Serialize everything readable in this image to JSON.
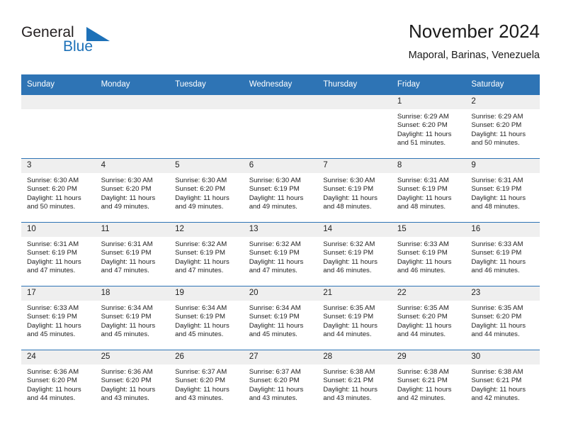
{
  "brand": {
    "name_part1": "General",
    "name_part2": "Blue",
    "logo_icon": "triangle-logo-icon",
    "accent_color": "#1d71b8"
  },
  "header": {
    "title": "November 2024",
    "subtitle": "Maporal, Barinas, Venezuela"
  },
  "theme": {
    "header_band_color": "#2e74b5",
    "daynum_band_color": "#efefef",
    "text_color": "#222222"
  },
  "calendar": {
    "weekday_headers": [
      "Sunday",
      "Monday",
      "Tuesday",
      "Wednesday",
      "Thursday",
      "Friday",
      "Saturday"
    ],
    "weeks": [
      [
        {
          "day": "",
          "empty": true
        },
        {
          "day": "",
          "empty": true
        },
        {
          "day": "",
          "empty": true
        },
        {
          "day": "",
          "empty": true
        },
        {
          "day": "",
          "empty": true
        },
        {
          "day": "1",
          "sunrise": "Sunrise: 6:29 AM",
          "sunset": "Sunset: 6:20 PM",
          "daylight1": "Daylight: 11 hours",
          "daylight2": "and 51 minutes."
        },
        {
          "day": "2",
          "sunrise": "Sunrise: 6:29 AM",
          "sunset": "Sunset: 6:20 PM",
          "daylight1": "Daylight: 11 hours",
          "daylight2": "and 50 minutes."
        }
      ],
      [
        {
          "day": "3",
          "sunrise": "Sunrise: 6:30 AM",
          "sunset": "Sunset: 6:20 PM",
          "daylight1": "Daylight: 11 hours",
          "daylight2": "and 50 minutes."
        },
        {
          "day": "4",
          "sunrise": "Sunrise: 6:30 AM",
          "sunset": "Sunset: 6:20 PM",
          "daylight1": "Daylight: 11 hours",
          "daylight2": "and 49 minutes."
        },
        {
          "day": "5",
          "sunrise": "Sunrise: 6:30 AM",
          "sunset": "Sunset: 6:20 PM",
          "daylight1": "Daylight: 11 hours",
          "daylight2": "and 49 minutes."
        },
        {
          "day": "6",
          "sunrise": "Sunrise: 6:30 AM",
          "sunset": "Sunset: 6:19 PM",
          "daylight1": "Daylight: 11 hours",
          "daylight2": "and 49 minutes."
        },
        {
          "day": "7",
          "sunrise": "Sunrise: 6:30 AM",
          "sunset": "Sunset: 6:19 PM",
          "daylight1": "Daylight: 11 hours",
          "daylight2": "and 48 minutes."
        },
        {
          "day": "8",
          "sunrise": "Sunrise: 6:31 AM",
          "sunset": "Sunset: 6:19 PM",
          "daylight1": "Daylight: 11 hours",
          "daylight2": "and 48 minutes."
        },
        {
          "day": "9",
          "sunrise": "Sunrise: 6:31 AM",
          "sunset": "Sunset: 6:19 PM",
          "daylight1": "Daylight: 11 hours",
          "daylight2": "and 48 minutes."
        }
      ],
      [
        {
          "day": "10",
          "sunrise": "Sunrise: 6:31 AM",
          "sunset": "Sunset: 6:19 PM",
          "daylight1": "Daylight: 11 hours",
          "daylight2": "and 47 minutes."
        },
        {
          "day": "11",
          "sunrise": "Sunrise: 6:31 AM",
          "sunset": "Sunset: 6:19 PM",
          "daylight1": "Daylight: 11 hours",
          "daylight2": "and 47 minutes."
        },
        {
          "day": "12",
          "sunrise": "Sunrise: 6:32 AM",
          "sunset": "Sunset: 6:19 PM",
          "daylight1": "Daylight: 11 hours",
          "daylight2": "and 47 minutes."
        },
        {
          "day": "13",
          "sunrise": "Sunrise: 6:32 AM",
          "sunset": "Sunset: 6:19 PM",
          "daylight1": "Daylight: 11 hours",
          "daylight2": "and 47 minutes."
        },
        {
          "day": "14",
          "sunrise": "Sunrise: 6:32 AM",
          "sunset": "Sunset: 6:19 PM",
          "daylight1": "Daylight: 11 hours",
          "daylight2": "and 46 minutes."
        },
        {
          "day": "15",
          "sunrise": "Sunrise: 6:33 AM",
          "sunset": "Sunset: 6:19 PM",
          "daylight1": "Daylight: 11 hours",
          "daylight2": "and 46 minutes."
        },
        {
          "day": "16",
          "sunrise": "Sunrise: 6:33 AM",
          "sunset": "Sunset: 6:19 PM",
          "daylight1": "Daylight: 11 hours",
          "daylight2": "and 46 minutes."
        }
      ],
      [
        {
          "day": "17",
          "sunrise": "Sunrise: 6:33 AM",
          "sunset": "Sunset: 6:19 PM",
          "daylight1": "Daylight: 11 hours",
          "daylight2": "and 45 minutes."
        },
        {
          "day": "18",
          "sunrise": "Sunrise: 6:34 AM",
          "sunset": "Sunset: 6:19 PM",
          "daylight1": "Daylight: 11 hours",
          "daylight2": "and 45 minutes."
        },
        {
          "day": "19",
          "sunrise": "Sunrise: 6:34 AM",
          "sunset": "Sunset: 6:19 PM",
          "daylight1": "Daylight: 11 hours",
          "daylight2": "and 45 minutes."
        },
        {
          "day": "20",
          "sunrise": "Sunrise: 6:34 AM",
          "sunset": "Sunset: 6:19 PM",
          "daylight1": "Daylight: 11 hours",
          "daylight2": "and 45 minutes."
        },
        {
          "day": "21",
          "sunrise": "Sunrise: 6:35 AM",
          "sunset": "Sunset: 6:19 PM",
          "daylight1": "Daylight: 11 hours",
          "daylight2": "and 44 minutes."
        },
        {
          "day": "22",
          "sunrise": "Sunrise: 6:35 AM",
          "sunset": "Sunset: 6:20 PM",
          "daylight1": "Daylight: 11 hours",
          "daylight2": "and 44 minutes."
        },
        {
          "day": "23",
          "sunrise": "Sunrise: 6:35 AM",
          "sunset": "Sunset: 6:20 PM",
          "daylight1": "Daylight: 11 hours",
          "daylight2": "and 44 minutes."
        }
      ],
      [
        {
          "day": "24",
          "sunrise": "Sunrise: 6:36 AM",
          "sunset": "Sunset: 6:20 PM",
          "daylight1": "Daylight: 11 hours",
          "daylight2": "and 44 minutes."
        },
        {
          "day": "25",
          "sunrise": "Sunrise: 6:36 AM",
          "sunset": "Sunset: 6:20 PM",
          "daylight1": "Daylight: 11 hours",
          "daylight2": "and 43 minutes."
        },
        {
          "day": "26",
          "sunrise": "Sunrise: 6:37 AM",
          "sunset": "Sunset: 6:20 PM",
          "daylight1": "Daylight: 11 hours",
          "daylight2": "and 43 minutes."
        },
        {
          "day": "27",
          "sunrise": "Sunrise: 6:37 AM",
          "sunset": "Sunset: 6:20 PM",
          "daylight1": "Daylight: 11 hours",
          "daylight2": "and 43 minutes."
        },
        {
          "day": "28",
          "sunrise": "Sunrise: 6:38 AM",
          "sunset": "Sunset: 6:21 PM",
          "daylight1": "Daylight: 11 hours",
          "daylight2": "and 43 minutes."
        },
        {
          "day": "29",
          "sunrise": "Sunrise: 6:38 AM",
          "sunset": "Sunset: 6:21 PM",
          "daylight1": "Daylight: 11 hours",
          "daylight2": "and 42 minutes."
        },
        {
          "day": "30",
          "sunrise": "Sunrise: 6:38 AM",
          "sunset": "Sunset: 6:21 PM",
          "daylight1": "Daylight: 11 hours",
          "daylight2": "and 42 minutes."
        }
      ]
    ]
  }
}
